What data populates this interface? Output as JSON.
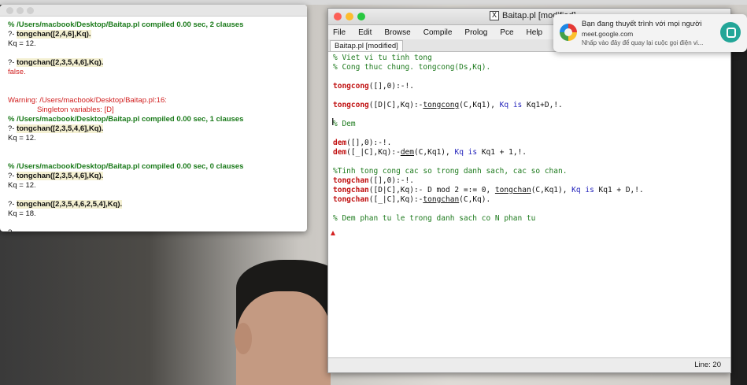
{
  "console": {
    "lines": [
      {
        "text": "% /Users/macbook/Desktop/Baitap.pl compiled 0.00 sec, 2 clauses",
        "style": "green"
      },
      {
        "prompt": "?- ",
        "query": "tongchan([2,4,6],Kq).",
        "style": "query"
      },
      {
        "text": "Kq = 12.",
        "style": "black"
      },
      {
        "text": "",
        "style": "black"
      },
      {
        "prompt": "?- ",
        "query": "tongchan([2,3,5,4,6],Kq).",
        "style": "query"
      },
      {
        "text": "false.",
        "style": "red"
      },
      {
        "text": "",
        "style": "black"
      },
      {
        "text": "",
        "style": "black"
      },
      {
        "text": "Warning: /Users/macbook/Desktop/Baitap.pl:16:",
        "style": "red"
      },
      {
        "text": "              Singleton variables: [D]",
        "style": "red"
      },
      {
        "text": "% /Users/macbook/Desktop/Baitap.pl compiled 0.00 sec, 1 clauses",
        "style": "green"
      },
      {
        "prompt": "?- ",
        "query": "tongchan([2,3,5,4,6],Kq).",
        "style": "query"
      },
      {
        "text": "Kq = 12.",
        "style": "black"
      },
      {
        "text": "",
        "style": "black"
      },
      {
        "text": "",
        "style": "black"
      },
      {
        "text": "% /Users/macbook/Desktop/Baitap.pl compiled 0.00 sec, 0 clauses",
        "style": "green"
      },
      {
        "prompt": "?- ",
        "query": "tongchan([2,3,5,4,6],Kq).",
        "style": "query"
      },
      {
        "text": "Kq = 12.",
        "style": "black"
      },
      {
        "text": "",
        "style": "black"
      },
      {
        "prompt": "?- ",
        "query": "tongchan([2,3,5,4,6,2,5,4],Kq).",
        "style": "query"
      },
      {
        "text": "Kq = 18.",
        "style": "black"
      },
      {
        "text": "",
        "style": "black"
      },
      {
        "text": "?-",
        "style": "black"
      }
    ]
  },
  "editor": {
    "title": "Baitap.pl [modified]",
    "menu": [
      "File",
      "Edit",
      "Browse",
      "Compile",
      "Prolog",
      "Pce",
      "Help"
    ],
    "tab": "Baitap.pl [modified]",
    "status": "Line: 20",
    "code": [
      [
        {
          "t": "% Viet vi tu tinh tong",
          "c": "comment"
        }
      ],
      [
        {
          "t": "% Cong thuc chung. tongcong(Ds,Kq).",
          "c": "comment"
        }
      ],
      [],
      [
        {
          "t": "tongcong",
          "c": "pred"
        },
        {
          "t": "([],0):-!.",
          "c": "plain"
        }
      ],
      [],
      [
        {
          "t": "tongcong",
          "c": "pred"
        },
        {
          "t": "([D|C],Kq):-",
          "c": "plain"
        },
        {
          "t": "tongcong",
          "c": "call"
        },
        {
          "t": "(C,Kq1), ",
          "c": "plain"
        },
        {
          "t": "Kq",
          "c": "var"
        },
        {
          "t": " is ",
          "c": "is"
        },
        {
          "t": "Kq1+D,!.",
          "c": "plain"
        }
      ],
      [],
      [
        {
          "t": "% Dem",
          "c": "comment"
        }
      ],
      [],
      [
        {
          "t": "dem",
          "c": "pred"
        },
        {
          "t": "([],0):-!.",
          "c": "plain"
        }
      ],
      [
        {
          "t": "dem",
          "c": "pred"
        },
        {
          "t": "([_|C],Kq):-",
          "c": "plain"
        },
        {
          "t": "dem",
          "c": "call"
        },
        {
          "t": "(C,Kq1), ",
          "c": "plain"
        },
        {
          "t": "Kq",
          "c": "var"
        },
        {
          "t": " is ",
          "c": "is"
        },
        {
          "t": "Kq1 + 1,!.",
          "c": "plain"
        }
      ],
      [],
      [
        {
          "t": "%Tinh tong cong cac so trong danh sach, cac so chan.",
          "c": "comment"
        }
      ],
      [
        {
          "t": "tongchan",
          "c": "pred"
        },
        {
          "t": "([],0):-!.",
          "c": "plain"
        }
      ],
      [
        {
          "t": "tongchan",
          "c": "pred"
        },
        {
          "t": "([D|C],Kq):- D mod 2 =:= 0, ",
          "c": "plain"
        },
        {
          "t": "tongchan",
          "c": "call"
        },
        {
          "t": "(C,Kq1), ",
          "c": "plain"
        },
        {
          "t": "Kq",
          "c": "var"
        },
        {
          "t": " is ",
          "c": "is"
        },
        {
          "t": "Kq1 + D,!.",
          "c": "plain"
        }
      ],
      [
        {
          "t": "tongchan",
          "c": "pred"
        },
        {
          "t": "([_|C],Kq):-",
          "c": "plain"
        },
        {
          "t": "tongchan",
          "c": "call"
        },
        {
          "t": "(C,Kq).",
          "c": "plain"
        }
      ],
      [],
      [
        {
          "t": "% Dem phan tu le trong danh sach co N phan tu",
          "c": "comment"
        }
      ]
    ]
  },
  "notification": {
    "title": "Bạn đang thuyết trình với mọi người",
    "source": "meet.google.com",
    "body": "Nhấp vào đây để quay lại cuộc gọi điện vi...",
    "logo_icon": "google-chrome-icon",
    "action_icon": "meet-present-icon"
  },
  "colors": {
    "console_green": "#1a7a1a",
    "console_red": "#d12020",
    "code_comment": "#1d7a1d",
    "code_pred": "#c01010",
    "code_var": "#2222bb"
  }
}
